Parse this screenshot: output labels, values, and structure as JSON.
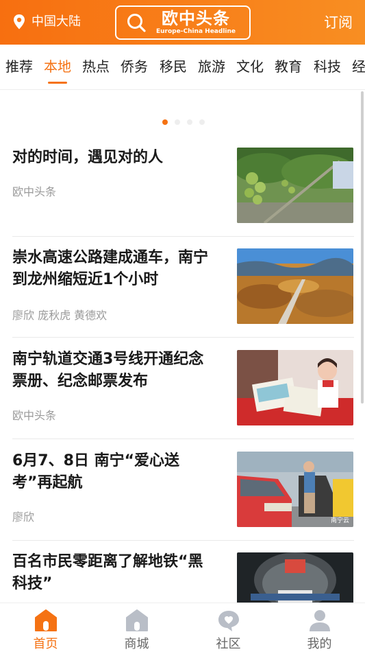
{
  "header": {
    "location": "中国大陆",
    "brand_main": "欧中头条",
    "brand_sub": "Europe-China Headline",
    "subscribe": "订阅"
  },
  "tabs": [
    {
      "label": "推荐"
    },
    {
      "label": "本地"
    },
    {
      "label": "热点"
    },
    {
      "label": "侨务"
    },
    {
      "label": "移民"
    },
    {
      "label": "旅游"
    },
    {
      "label": "文化"
    },
    {
      "label": "教育"
    },
    {
      "label": "科技"
    },
    {
      "label": "经"
    }
  ],
  "active_tab": "本地",
  "carousel": {
    "total": 4,
    "active": 1
  },
  "news": [
    {
      "title": "对的时间，遇见对的人",
      "meta": "欧中头条",
      "thumb": "orchard-photo"
    },
    {
      "title": "崇水高速公路建成通车，南宁到龙州缩短近1个小时",
      "meta": "廖欣 庞秋虎 黄德欢",
      "thumb": "highway-landscape-photo"
    },
    {
      "title": "南宁轨道交通3号线开通纪念票册、纪念邮票发布",
      "meta": "欧中头条",
      "thumb": "ticket-booklet-photo"
    },
    {
      "title": "6月7、8日 南宁“爱心送考”再起航",
      "meta": "廖欣",
      "thumb": "taxi-volunteer-photo",
      "thumb_label": "南宁云"
    },
    {
      "title": "百名市民零距离了解地铁“黑科技”",
      "meta": "",
      "thumb": "metro-tunnel-photo"
    }
  ],
  "bottom_nav": [
    {
      "label": "首页",
      "icon": "home-icon"
    },
    {
      "label": "商城",
      "icon": "shop-icon"
    },
    {
      "label": "社区",
      "icon": "community-icon"
    },
    {
      "label": "我的",
      "icon": "profile-icon"
    }
  ],
  "colors": {
    "accent": "#f57213",
    "header_start": "#f76f10",
    "header_end": "#f88e22",
    "muted": "#9a9a9a"
  }
}
